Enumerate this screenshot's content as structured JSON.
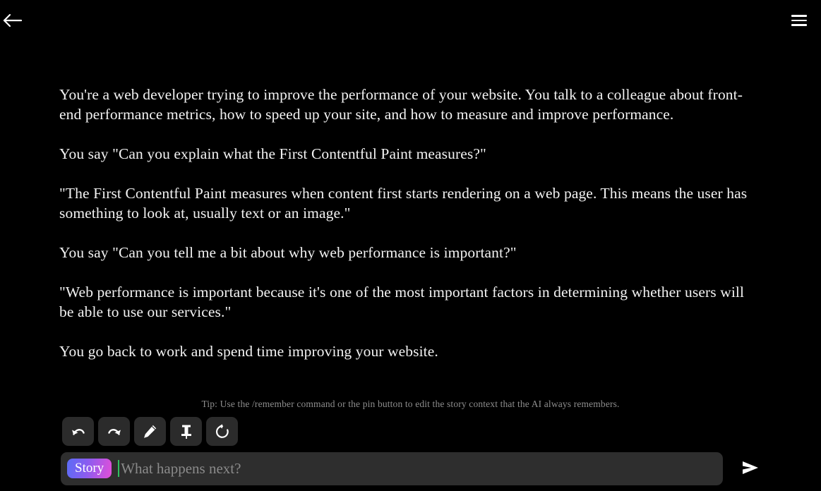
{
  "app": {
    "background_color": "#000000",
    "text_color": "#f2f2f2"
  },
  "topbar": {
    "back_label": "Back",
    "back_icon": "arrow-left-icon",
    "menu_label": "Menu",
    "menu_icon": "hamburger-menu-icon"
  },
  "story": {
    "paragraphs": [
      "You're a web developer trying to improve the performance of your website. You talk to a colleague about front-end performance metrics, how to speed up your site, and how to measure and improve performance.",
      "You say \"Can you explain what the First Contentful Paint measures?\"",
      "\"The First Contentful Paint measures when content first starts rendering on a web page. This means the user has something to look at, usually text or an image.\"",
      "You say \"Can you tell me a bit about why web performance is important?\"",
      "\"Web performance is important because it's one of the most important factors in determining whether users will be able to use our services.\"",
      "You go back to work and spend time improving your website."
    ]
  },
  "tip": {
    "text": "Tip: Use the /remember command or the pin button to edit the story context that the AI always remembers."
  },
  "toolbar": {
    "buttons": [
      {
        "name": "undo-button",
        "label": "Undo",
        "icon": "undo-icon"
      },
      {
        "name": "redo-button",
        "label": "Redo",
        "icon": "redo-icon"
      },
      {
        "name": "edit-button",
        "label": "Edit",
        "icon": "pencil-icon"
      },
      {
        "name": "pin-button",
        "label": "Pin",
        "icon": "pin-icon"
      },
      {
        "name": "retry-button",
        "label": "Retry",
        "icon": "refresh-icon"
      }
    ]
  },
  "composer": {
    "mode_label": "Story",
    "mode_gradient_start": "#5b6cf5",
    "mode_gradient_end": "#e24fd8",
    "input_value": "",
    "input_placeholder": "What happens next?",
    "caret_color": "#2fbf5f",
    "send_label": "Send",
    "send_icon": "send-arrow-icon"
  }
}
